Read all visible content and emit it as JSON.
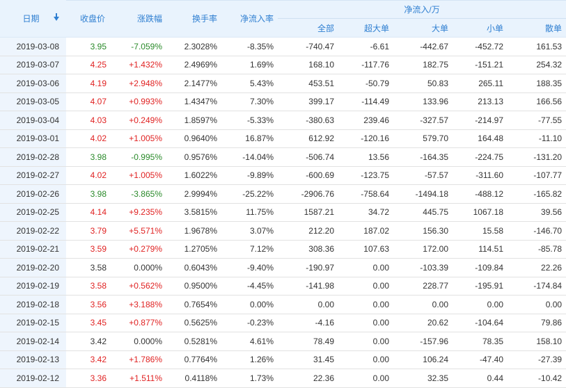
{
  "colors": {
    "up": "#e02222",
    "down": "#2a8a2a",
    "flat": "#333333",
    "header_text": "#2f7fd1",
    "header_bg": "#e9f3fd"
  },
  "headers": {
    "date": "日期",
    "sort_icon": "sort-down-arrow-icon",
    "close": "收盘价",
    "change": "涨跌幅",
    "turnover": "换手率",
    "net_rate": "净流入率",
    "net_group": "净流入/万",
    "all": "全部",
    "xl": "超大单",
    "l": "大单",
    "m": "小单",
    "s": "散单"
  },
  "rows": [
    {
      "date": "2019-03-08",
      "close": "3.95",
      "change": "-7.059%",
      "turnover": "2.3028%",
      "rate": "-8.35%",
      "all": "-740.47",
      "xl": "-6.61",
      "l": "-442.67",
      "m": "-452.72",
      "s": "161.53",
      "dir": "down"
    },
    {
      "date": "2019-03-07",
      "close": "4.25",
      "change": "+1.432%",
      "turnover": "2.4969%",
      "rate": "1.69%",
      "all": "168.10",
      "xl": "-117.76",
      "l": "182.75",
      "m": "-151.21",
      "s": "254.32",
      "dir": "up"
    },
    {
      "date": "2019-03-06",
      "close": "4.19",
      "change": "+2.948%",
      "turnover": "2.1477%",
      "rate": "5.43%",
      "all": "453.51",
      "xl": "-50.79",
      "l": "50.83",
      "m": "265.11",
      "s": "188.35",
      "dir": "up"
    },
    {
      "date": "2019-03-05",
      "close": "4.07",
      "change": "+0.993%",
      "turnover": "1.4347%",
      "rate": "7.30%",
      "all": "399.17",
      "xl": "-114.49",
      "l": "133.96",
      "m": "213.13",
      "s": "166.56",
      "dir": "up"
    },
    {
      "date": "2019-03-04",
      "close": "4.03",
      "change": "+0.249%",
      "turnover": "1.8597%",
      "rate": "-5.33%",
      "all": "-380.63",
      "xl": "239.46",
      "l": "-327.57",
      "m": "-214.97",
      "s": "-77.55",
      "dir": "up"
    },
    {
      "date": "2019-03-01",
      "close": "4.02",
      "change": "+1.005%",
      "turnover": "0.9640%",
      "rate": "16.87%",
      "all": "612.92",
      "xl": "-120.16",
      "l": "579.70",
      "m": "164.48",
      "s": "-11.10",
      "dir": "up"
    },
    {
      "date": "2019-02-28",
      "close": "3.98",
      "change": "-0.995%",
      "turnover": "0.9576%",
      "rate": "-14.04%",
      "all": "-506.74",
      "xl": "13.56",
      "l": "-164.35",
      "m": "-224.75",
      "s": "-131.20",
      "dir": "down"
    },
    {
      "date": "2019-02-27",
      "close": "4.02",
      "change": "+1.005%",
      "turnover": "1.6022%",
      "rate": "-9.89%",
      "all": "-600.69",
      "xl": "-123.75",
      "l": "-57.57",
      "m": "-311.60",
      "s": "-107.77",
      "dir": "up"
    },
    {
      "date": "2019-02-26",
      "close": "3.98",
      "change": "-3.865%",
      "turnover": "2.9994%",
      "rate": "-25.22%",
      "all": "-2906.76",
      "xl": "-758.64",
      "l": "-1494.18",
      "m": "-488.12",
      "s": "-165.82",
      "dir": "down"
    },
    {
      "date": "2019-02-25",
      "close": "4.14",
      "change": "+9.235%",
      "turnover": "3.5815%",
      "rate": "11.75%",
      "all": "1587.21",
      "xl": "34.72",
      "l": "445.75",
      "m": "1067.18",
      "s": "39.56",
      "dir": "up"
    },
    {
      "date": "2019-02-22",
      "close": "3.79",
      "change": "+5.571%",
      "turnover": "1.9678%",
      "rate": "3.07%",
      "all": "212.20",
      "xl": "187.02",
      "l": "156.30",
      "m": "15.58",
      "s": "-146.70",
      "dir": "up"
    },
    {
      "date": "2019-02-21",
      "close": "3.59",
      "change": "+0.279%",
      "turnover": "1.2705%",
      "rate": "7.12%",
      "all": "308.36",
      "xl": "107.63",
      "l": "172.00",
      "m": "114.51",
      "s": "-85.78",
      "dir": "up"
    },
    {
      "date": "2019-02-20",
      "close": "3.58",
      "change": "0.000%",
      "turnover": "0.6043%",
      "rate": "-9.40%",
      "all": "-190.97",
      "xl": "0.00",
      "l": "-103.39",
      "m": "-109.84",
      "s": "22.26",
      "dir": "flat"
    },
    {
      "date": "2019-02-19",
      "close": "3.58",
      "change": "+0.562%",
      "turnover": "0.9500%",
      "rate": "-4.45%",
      "all": "-141.98",
      "xl": "0.00",
      "l": "228.77",
      "m": "-195.91",
      "s": "-174.84",
      "dir": "up"
    },
    {
      "date": "2019-02-18",
      "close": "3.56",
      "change": "+3.188%",
      "turnover": "0.7654%",
      "rate": "0.00%",
      "all": "0.00",
      "xl": "0.00",
      "l": "0.00",
      "m": "0.00",
      "s": "0.00",
      "dir": "up"
    },
    {
      "date": "2019-02-15",
      "close": "3.45",
      "change": "+0.877%",
      "turnover": "0.5625%",
      "rate": "-0.23%",
      "all": "-4.16",
      "xl": "0.00",
      "l": "20.62",
      "m": "-104.64",
      "s": "79.86",
      "dir": "up"
    },
    {
      "date": "2019-02-14",
      "close": "3.42",
      "change": "0.000%",
      "turnover": "0.5281%",
      "rate": "4.61%",
      "all": "78.49",
      "xl": "0.00",
      "l": "-157.96",
      "m": "78.35",
      "s": "158.10",
      "dir": "flat"
    },
    {
      "date": "2019-02-13",
      "close": "3.42",
      "change": "+1.786%",
      "turnover": "0.7764%",
      "rate": "1.26%",
      "all": "31.45",
      "xl": "0.00",
      "l": "106.24",
      "m": "-47.40",
      "s": "-27.39",
      "dir": "up"
    },
    {
      "date": "2019-02-12",
      "close": "3.36",
      "change": "+1.511%",
      "turnover": "0.4118%",
      "rate": "1.73%",
      "all": "22.36",
      "xl": "0.00",
      "l": "32.35",
      "m": "0.44",
      "s": "-10.42",
      "dir": "up"
    }
  ]
}
